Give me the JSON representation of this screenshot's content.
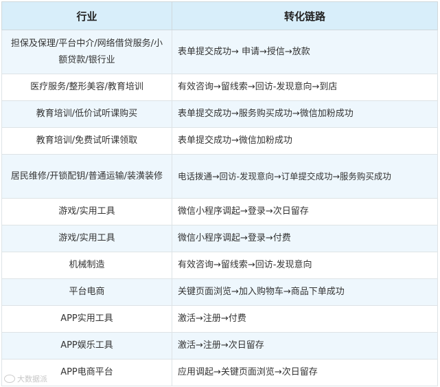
{
  "table": {
    "header": {
      "industry": "行业",
      "conversion_path": "转化链路"
    },
    "rows": [
      {
        "industry": "担保及保理/平台中介/网络借贷服务/小额贷款/银行业",
        "path": "表单提交成功→ 申请→授信→放款"
      },
      {
        "industry": "医疗服务/整形美容/教育培训",
        "path": "有效咨询→留线索→回访-发现意向→到店"
      },
      {
        "industry": "教育培训/低价试听课购买",
        "path": "表单提交成功→服务购买成功→微信加粉成功"
      },
      {
        "industry": "教育培训/免费试听课领取",
        "path": "表单提交成功→微信加粉成功"
      },
      {
        "industry": "居民维修/开锁配钥/普通运输/装潢装修",
        "path": "电话拨通→回访-发现意向→订单提交成功→服务购买成功"
      },
      {
        "industry": "游戏/实用工具",
        "path": "微信小程序调起→登录→次日留存"
      },
      {
        "industry": "游戏/实用工具",
        "path": "微信小程序调起→登录→付费"
      },
      {
        "industry": "机械制造",
        "path": "有效咨询→留线索→回访-发现意向"
      },
      {
        "industry": "平台电商",
        "path": "关键页面浏览→加入购物车→商品下单成功"
      },
      {
        "industry": "APP实用工具",
        "path": "激活→注册→付费"
      },
      {
        "industry": "APP娱乐工具",
        "path": "激活→注册→次日留存"
      },
      {
        "industry": "APP电商平台",
        "path": "应用调起→关键页面浏览→次日留存"
      }
    ]
  },
  "watermark": {
    "text": "大数据派",
    "icon": "watermark-logo-icon"
  }
}
